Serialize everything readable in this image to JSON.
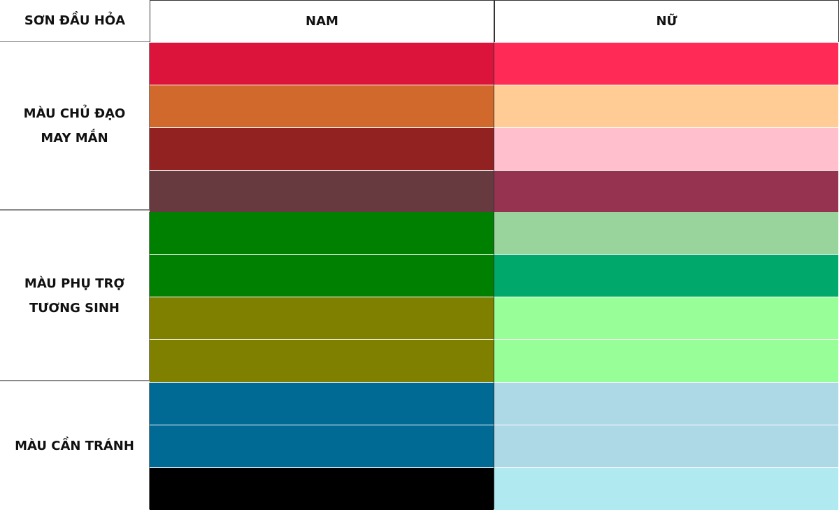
{
  "header": {
    "corner": "SƠN ĐẦU HỎA",
    "col_male": "NAM",
    "col_female": "NỮ"
  },
  "groups": [
    {
      "line1": "MÀU CHỦ ĐẠO",
      "line2": "MAY MẮN",
      "male": [
        "#dc143c",
        "#d2692c",
        "#922222",
        "#673a3f"
      ],
      "female": [
        "#ff2a55",
        "#ffcc96",
        "#ffbfcc",
        "#963350"
      ]
    },
    {
      "line1": "MÀU PHỤ TRỢ",
      "line2": "TƯƠNG SINH",
      "male": [
        "#008000",
        "#008000",
        "#808000",
        "#808000"
      ],
      "female": [
        "#98d49b",
        "#00a86b",
        "#98ff98",
        "#98ff98"
      ]
    },
    {
      "line1": "MÀU CẦN TRÁNH",
      "line2": "",
      "male": [
        "#006994",
        "#006994",
        "#000000"
      ],
      "female": [
        "#add8e5",
        "#add8e5",
        "#b0eaf0"
      ]
    }
  ]
}
